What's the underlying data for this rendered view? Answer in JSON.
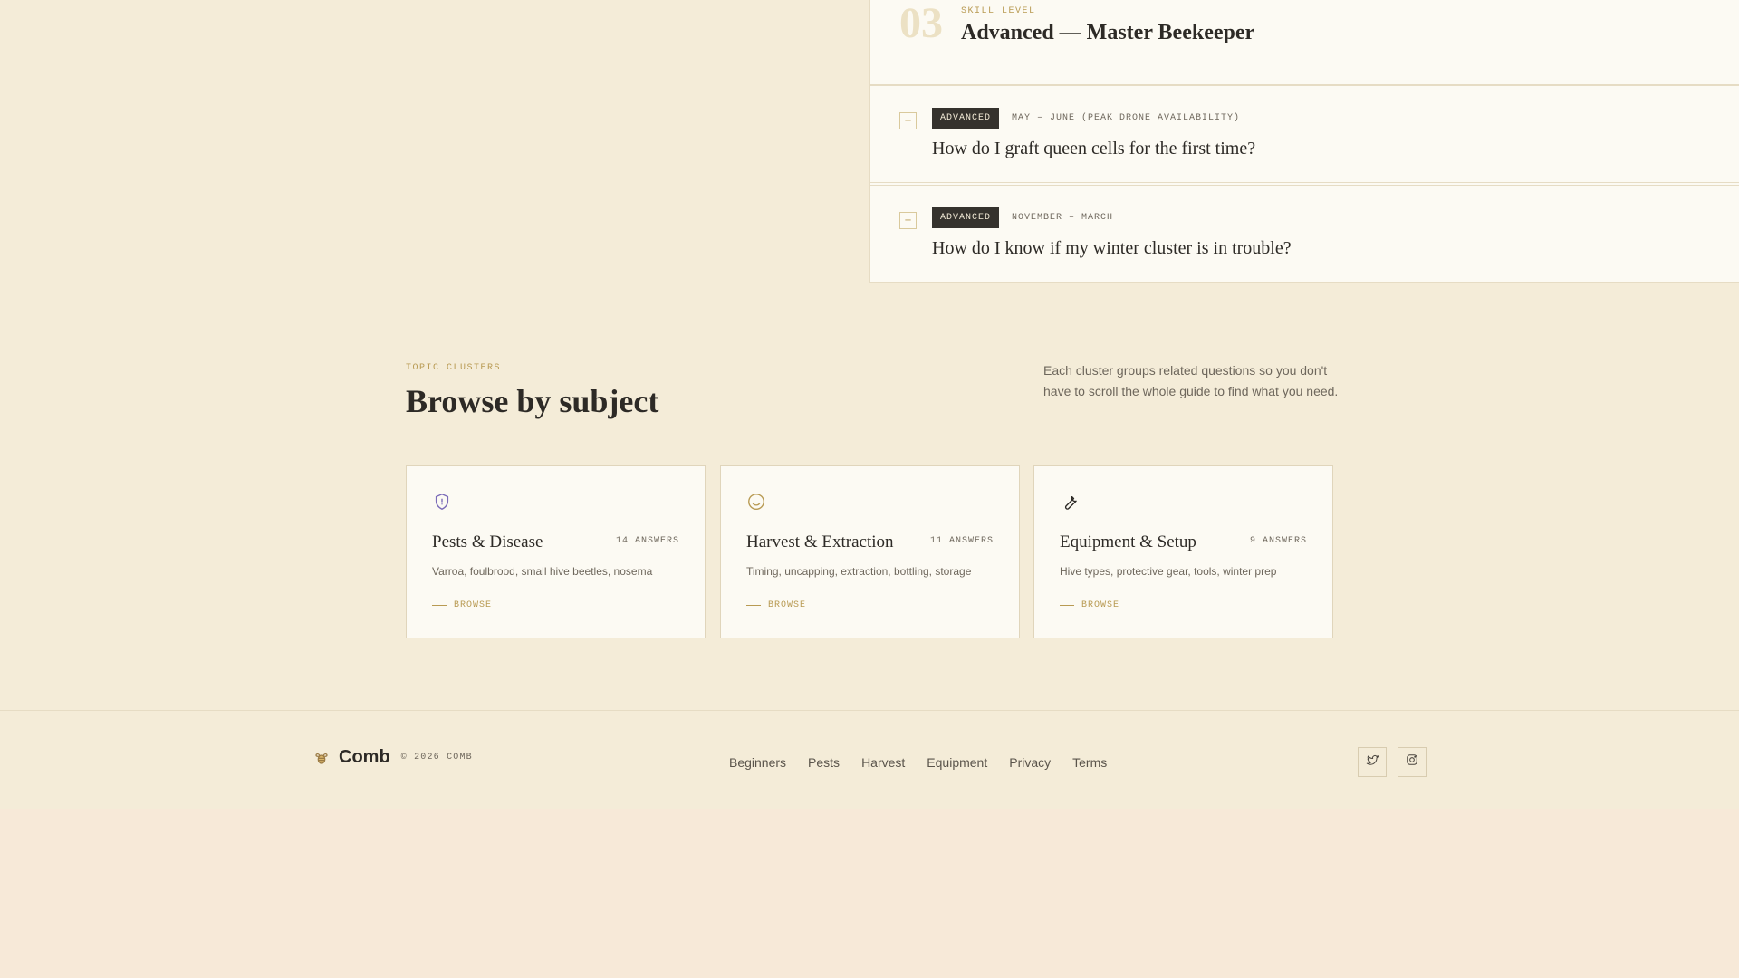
{
  "faq": {
    "level_number": "03",
    "level_eyebrow": "SKILL LEVEL",
    "level_title": "Advanced — Master Beekeeper",
    "items": [
      {
        "expand_glyph": "+",
        "tag": "ADVANCED",
        "season": "MAY – JUNE (PEAK DRONE AVAILABILITY)",
        "question": "How do I graft queen cells for the first time?"
      },
      {
        "expand_glyph": "+",
        "tag": "ADVANCED",
        "season": "NOVEMBER – MARCH",
        "question": "How do I know if my winter cluster is in trouble?"
      }
    ]
  },
  "topics": {
    "eyebrow": "TOPIC CLUSTERS",
    "title": "Browse by subject",
    "description": "Each cluster groups related questions so you don't have to scroll the whole guide to find what you need.",
    "cards": [
      {
        "icon": "shield-icon",
        "icon_color": "#7b6bb8",
        "title": "Pests & Disease",
        "count": "14 ANSWERS",
        "desc": "Varroa, foulbrood, small hive beetles, nosema",
        "link": "BROWSE"
      },
      {
        "icon": "smile-icon",
        "icon_color": "#b89a52",
        "title": "Harvest & Extraction",
        "count": "11 ANSWERS",
        "desc": "Timing, uncapping, extraction, bottling, storage",
        "link": "BROWSE"
      },
      {
        "icon": "wrench-icon",
        "icon_color": "#2d2a26",
        "title": "Equipment & Setup",
        "count": "9 ANSWERS",
        "desc": "Hive types, protective gear, tools, winter prep",
        "link": "BROWSE"
      }
    ]
  },
  "footer": {
    "brand_icon": "bee-icon",
    "brand": "Comb",
    "copyright": "© 2026 COMB",
    "nav": [
      "Beginners",
      "Pests",
      "Harvest",
      "Equipment",
      "Privacy",
      "Terms"
    ],
    "socials": [
      "twitter-icon",
      "instagram-icon"
    ]
  },
  "colors": {
    "accent": "#b89a52",
    "background": "#f4ecd8",
    "card": "#fcfaf3",
    "tag_bg": "#35322d",
    "text": "#2d2a26"
  }
}
